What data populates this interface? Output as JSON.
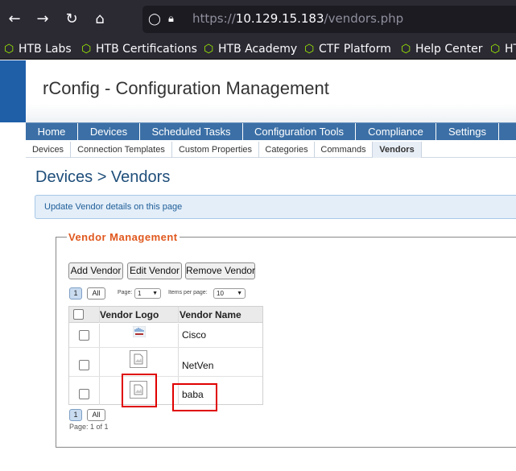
{
  "browser": {
    "url_scheme": "https://",
    "url_host": "10.129.15.183",
    "url_path": "/vendors.php",
    "bookmarks": [
      {
        "label": "HTB Labs"
      },
      {
        "label": "HTB Certifications"
      },
      {
        "label": "HTB Academy"
      },
      {
        "label": "CTF Platform"
      },
      {
        "label": "Help Center"
      },
      {
        "label": "HT"
      }
    ]
  },
  "app": {
    "title": "rConfig - Configuration Management"
  },
  "main_nav": [
    {
      "label": "Home"
    },
    {
      "label": "Devices"
    },
    {
      "label": "Scheduled Tasks"
    },
    {
      "label": "Configuration Tools"
    },
    {
      "label": "Compliance"
    },
    {
      "label": "Settings"
    }
  ],
  "sub_nav": [
    {
      "label": "Devices"
    },
    {
      "label": "Connection Templates"
    },
    {
      "label": "Custom Properties"
    },
    {
      "label": "Categories"
    },
    {
      "label": "Commands"
    },
    {
      "label": "Vendors",
      "active": true
    }
  ],
  "page": {
    "title": "Devices > Vendors",
    "info": "Update Vendor details on this page"
  },
  "vendor_mgmt": {
    "legend": "Vendor Management",
    "buttons": {
      "add": "Add Vendor",
      "edit": "Edit Vendor",
      "remove": "Remove Vendor"
    },
    "pager": {
      "current_page": "1",
      "all_label": "All",
      "page_label": "Page:",
      "page_value": "1",
      "per_page_label": "Items per page:",
      "per_page_value": "10",
      "page_info": "Page: 1 of 1"
    },
    "columns": {
      "logo": "Vendor Logo",
      "name": "Vendor Name"
    },
    "rows": [
      {
        "name": "Cisco",
        "logo": "cisco-logo"
      },
      {
        "name": "NetVen",
        "logo": "broken-image-icon"
      },
      {
        "name": "baba",
        "logo": "broken-image-icon"
      }
    ]
  },
  "colors": {
    "nav_bg": "#3a6ea5",
    "legend": "#e0581e",
    "highlight": "#e00000",
    "info_bg": "#e3eef9"
  }
}
